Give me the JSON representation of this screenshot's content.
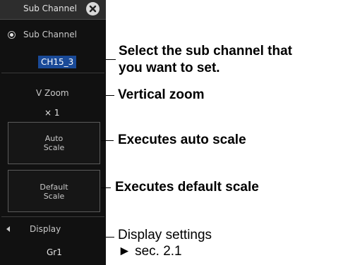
{
  "panel": {
    "title": "Sub Channel",
    "radio_label": "Sub Channel",
    "sub_channel_value": "CH15_3",
    "vzoom_label": "V Zoom",
    "vzoom_value": "× 1",
    "auto_scale_line1": "Auto",
    "auto_scale_line2": "Scale",
    "default_scale_line1": "Default",
    "default_scale_line2": "Scale",
    "display_label": "Display",
    "display_value": "Gr1",
    "icons": {
      "close": "close-icon",
      "radio": "radio-selected-icon",
      "display_arrow": "arrow-left-icon"
    }
  },
  "callouts": {
    "sub_channel_line1": "Select the sub channel that",
    "sub_channel_line2": "you want to set.",
    "vzoom": "Vertical zoom",
    "auto_scale": "Executes auto scale",
    "default_scale": "Executes default scale",
    "display_line1": "Display settings",
    "display_line2": "► sec. 2.1"
  },
  "colors": {
    "panel_bg": "#111111",
    "highlight": "#1a4a98",
    "text_light": "#c9c9c9"
  }
}
